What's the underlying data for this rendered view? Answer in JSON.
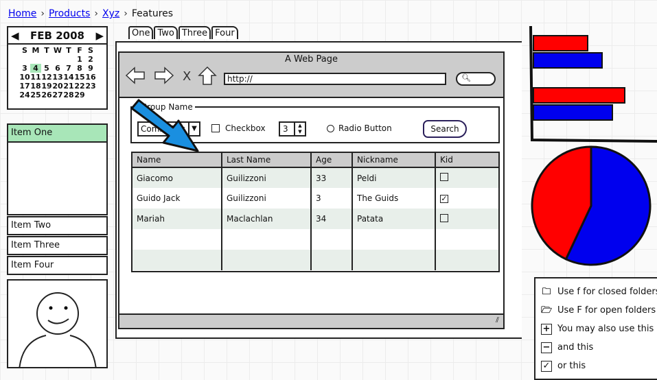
{
  "breadcrumb": {
    "links": [
      "Home",
      "Products",
      "Xyz"
    ],
    "current": "Features"
  },
  "calendar": {
    "title": "FEB 2008",
    "weekdays": [
      "S",
      "M",
      "T",
      "W",
      "T",
      "F",
      "S"
    ],
    "days": [
      "",
      "",
      "",
      "",
      "",
      "1",
      "2",
      "3",
      "4",
      "5",
      "6",
      "7",
      "8",
      "9",
      "10",
      "11",
      "12",
      "13",
      "14",
      "15",
      "16",
      "17",
      "18",
      "19",
      "20",
      "21",
      "22",
      "23",
      "24",
      "25",
      "26",
      "27",
      "28",
      "29"
    ],
    "selected": "4"
  },
  "accordion": {
    "items": [
      "Item One",
      "Item Two",
      "Item Three",
      "Item Four"
    ],
    "active": "Item One"
  },
  "tabs": [
    "One",
    "Two",
    "Three",
    "Four"
  ],
  "browser": {
    "title": "A Web Page",
    "url": "http://"
  },
  "form": {
    "group": "Group Name",
    "combo": "ComboBox",
    "checkbox": "Checkbox",
    "stepper": "3",
    "radio": "Radio Button",
    "search": "Search"
  },
  "table": {
    "columns": [
      "Name",
      "Last Name",
      "Age",
      "Nickname",
      "Kid"
    ],
    "rows": [
      [
        "Giacomo",
        "Guilizzoni",
        "33",
        "Peldi",
        false
      ],
      [
        "Guido Jack",
        "Guilizzoni",
        "3",
        "The Guids",
        true
      ],
      [
        "Mariah",
        "Maclachlan",
        "34",
        "Patata",
        false
      ],
      [
        "",
        "",
        "",
        "",
        null
      ],
      [
        "",
        "",
        "",
        "",
        null
      ]
    ]
  },
  "legend": [
    {
      "icon": "folder-closed-icon",
      "text": "Use f for closed folders"
    },
    {
      "icon": "folder-open-icon",
      "text": "Use F for open folders"
    },
    {
      "icon": "plus-box-icon",
      "text": "You may also use this"
    },
    {
      "icon": "minus-box-icon",
      "text": "and this"
    },
    {
      "icon": "checked-box-icon",
      "text": "or this"
    }
  ],
  "colors": {
    "red": "#ff0000",
    "blue": "#0000ee",
    "arrow": "#1a8fe0",
    "selected": "#a8e6b8"
  },
  "chart_data": [
    {
      "type": "bar",
      "orientation": "horizontal",
      "series": [
        {
          "color": "#ff0000",
          "values": [
            79,
            133
          ]
        },
        {
          "color": "#0000ee",
          "values": [
            100,
            115
          ]
        }
      ]
    },
    {
      "type": "pie",
      "values": [
        57,
        43
      ],
      "colors": [
        "#0000ee",
        "#ff0000"
      ]
    }
  ]
}
